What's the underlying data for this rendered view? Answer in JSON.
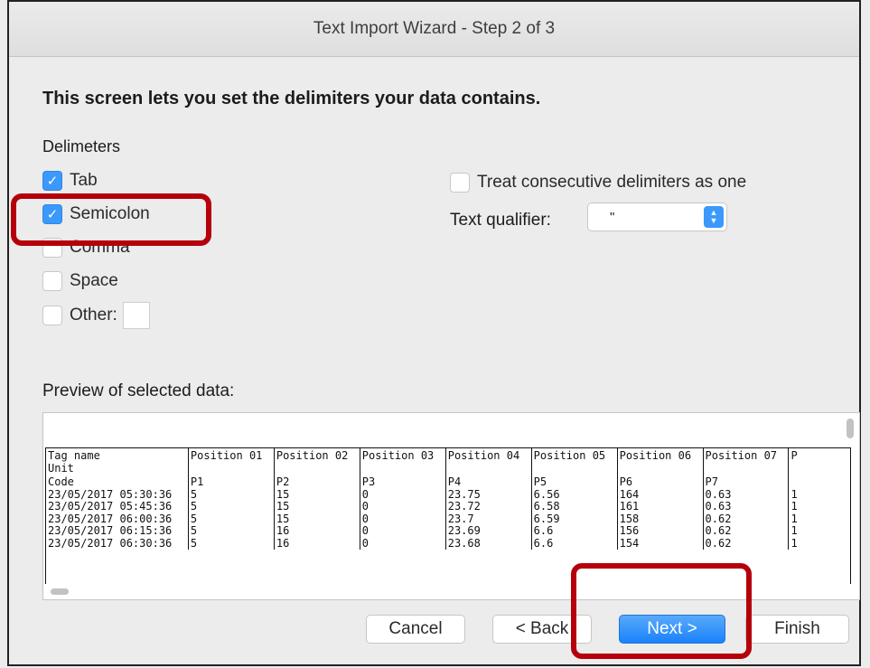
{
  "window": {
    "title": "Text Import Wizard - Step 2 of 3"
  },
  "heading": "This screen lets you set the delimiters your data contains.",
  "delimiters": {
    "label": "Delimeters",
    "tab": "Tab",
    "semicolon": "Semicolon",
    "comma": "Comma",
    "space": "Space",
    "other": "Other:",
    "checked": [
      "Tab",
      "Semicolon"
    ]
  },
  "options": {
    "consecutive": "Treat consecutive delimiters as one",
    "qualifier_label": "Text qualifier:",
    "qualifier_value": "\""
  },
  "preview": {
    "label": "Preview of selected data:",
    "headers": [
      "Tag name\nUnit",
      "Position 01",
      "Position 02",
      "Position 03",
      "Position 04",
      "Position 05",
      "Position 06",
      "Position 07",
      "P"
    ],
    "rows": [
      [
        "Code",
        "P1",
        "P2",
        "P3",
        "P4",
        "P5",
        "P6",
        "P7",
        ""
      ],
      [
        "23/05/2017 05:30:36",
        "5",
        "15",
        "0",
        "23.75",
        "6.56",
        "164",
        "0.63",
        "1"
      ],
      [
        "23/05/2017 05:45:36",
        "5",
        "15",
        "0",
        "23.72",
        "6.58",
        "161",
        "0.63",
        "1"
      ],
      [
        "23/05/2017 06:00:36",
        "5",
        "15",
        "0",
        "23.7",
        "6.59",
        "158",
        "0.62",
        "1"
      ],
      [
        "23/05/2017 06:15:36",
        "5",
        "16",
        "0",
        "23.69",
        "6.6",
        "156",
        "0.62",
        "1"
      ],
      [
        "23/05/2017 06:30:36",
        "5",
        "16",
        "0",
        "23.68",
        "6.6",
        "154",
        "0.62",
        "1"
      ]
    ]
  },
  "buttons": {
    "cancel": "Cancel",
    "back": "< Back",
    "next": "Next >",
    "finish": "Finish"
  },
  "colors": {
    "accent": "#3b99fc",
    "highlight": "#b5000c"
  }
}
